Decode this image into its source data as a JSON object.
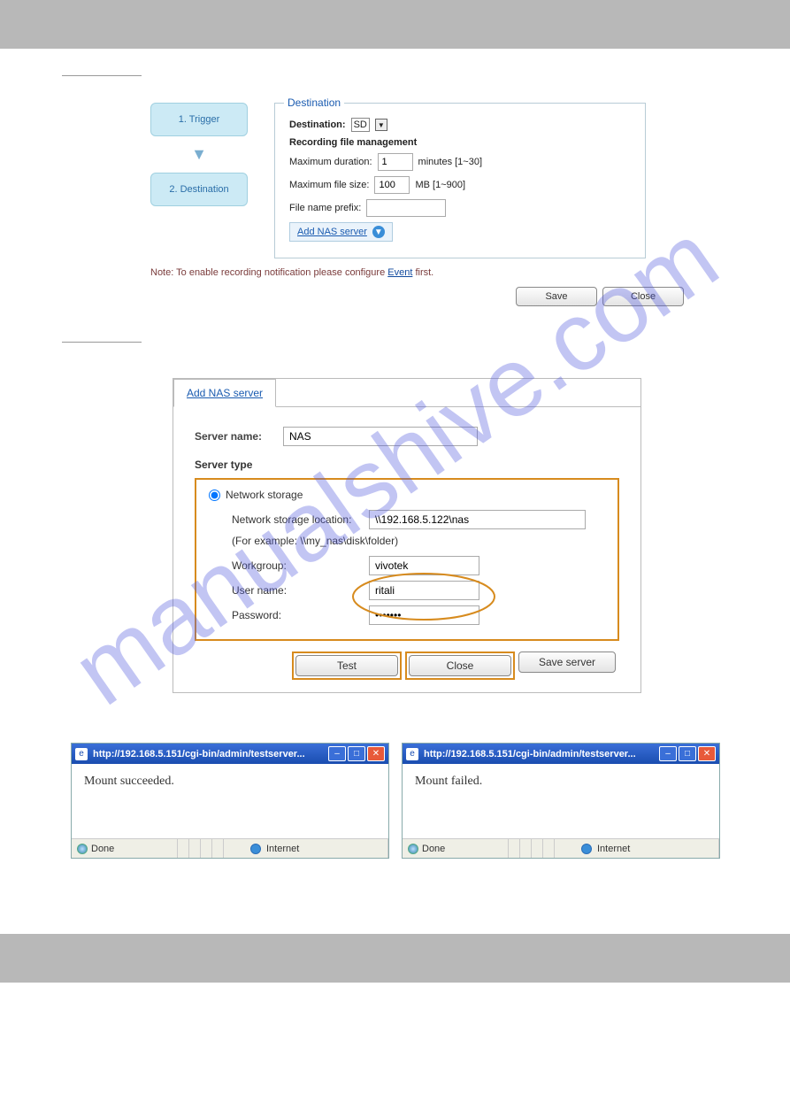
{
  "watermark": "manualshive.com",
  "recording": {
    "wizard": {
      "step1": "1.  Trigger",
      "step2": "2.  Destination"
    },
    "fieldset_title": "Destination",
    "dest_label": "Destination:",
    "dest_value": "SD",
    "section_label": "Recording file management",
    "max_dur_label": "Maximum duration:",
    "max_dur_value": "1",
    "max_dur_unit": "minutes [1~30]",
    "max_size_label": "Maximum file size:",
    "max_size_value": "100",
    "max_size_unit": "MB [1~900]",
    "prefix_label": "File name prefix:",
    "prefix_value": "",
    "add_nas": "Add NAS server",
    "note_prefix": "Note: To enable recording notification please configure ",
    "note_link": "Event",
    "note_suffix": " first.",
    "save": "Save",
    "close": "Close"
  },
  "nas": {
    "tab": "Add NAS server",
    "server_name_label": "Server name:",
    "server_name_value": "NAS",
    "server_type_label": "Server type",
    "radio_label": "Network storage",
    "loc_label": "Network storage location:",
    "loc_value": "\\\\192.168.5.122\\nas",
    "hint": "(For example: \\\\my_nas\\disk\\folder)",
    "wg_label": "Workgroup:",
    "wg_value": "vivotek",
    "user_label": "User name:",
    "user_value": "ritali",
    "pwd_label": "Password:",
    "pwd_value": "•••••••",
    "test": "Test",
    "close": "Close",
    "save": "Save server"
  },
  "popups": {
    "url": "http://192.168.5.151/cgi-bin/admin/testserver...",
    "ok_msg": "Mount succeeded.",
    "fail_msg": "Mount failed.",
    "done": "Done",
    "internet": "Internet"
  }
}
